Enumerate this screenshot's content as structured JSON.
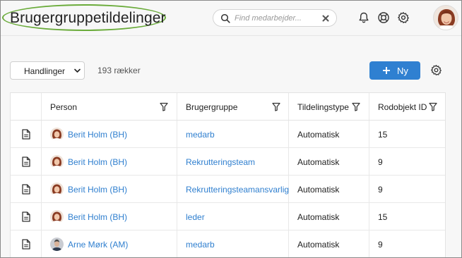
{
  "header": {
    "title": "Brugergruppetildelinger",
    "search_placeholder": "Find medarbejder...",
    "icons": [
      "bell-icon",
      "help-lifebuoy-icon",
      "gear-icon",
      "user-avatar"
    ]
  },
  "toolbar": {
    "actions_label": "Handlinger",
    "row_count": "193 rækker",
    "new_label": "Ny"
  },
  "table": {
    "columns": [
      "Person",
      "Brugergruppe",
      "Tildelingstype",
      "Rodobjekt ID"
    ],
    "rows": [
      {
        "person": "Berit Holm (BH)",
        "group": "medarb",
        "type": "Automatisk",
        "root_id": "15",
        "avatar": "female"
      },
      {
        "person": "Berit Holm (BH)",
        "group": "Rekrutteringsteam",
        "type": "Automatisk",
        "root_id": "9",
        "avatar": "female"
      },
      {
        "person": "Berit Holm (BH)",
        "group": "Rekrutteringsteamansvarlig",
        "type": "Automatisk",
        "root_id": "9",
        "avatar": "female"
      },
      {
        "person": "Berit Holm (BH)",
        "group": "leder",
        "type": "Automatisk",
        "root_id": "15",
        "avatar": "female"
      },
      {
        "person": "Arne Mørk (AM)",
        "group": "medarb",
        "type": "Automatisk",
        "root_id": "9",
        "avatar": "male"
      }
    ]
  },
  "colors": {
    "primary": "#2f80d1",
    "link": "#2f7fcf",
    "highlight_ellipse": "#6aab3a"
  }
}
